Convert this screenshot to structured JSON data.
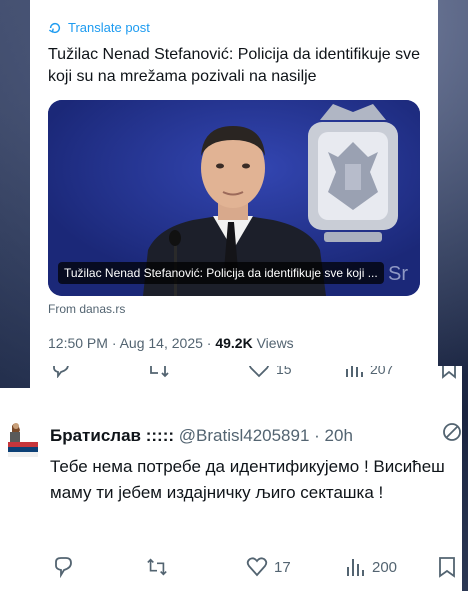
{
  "translate_label": "Translate post",
  "headline": "Tužilac Nenad Stefanović: Policija da identifikuje sve koji su na mrežama pozivali na nasilje",
  "media": {
    "caption": "Tužilac Nenad Stefanović: Policija da identifikuje sve koji ...",
    "source": "From danas.rs"
  },
  "meta": {
    "time": "12:50 PM · Aug 14, 2025 · ",
    "views_count": "49.2K",
    "views_label": " Views"
  },
  "strip": {
    "likes": "15",
    "views": "207"
  },
  "reply": {
    "name": "Братислав :::::",
    "handle": " @Bratisl4205891 · 20h",
    "text": "Тебе нема потребе да идентификујемо ! Висићеш маму ти јебем издајничку љиго секташка !",
    "likes": "17",
    "views": "200"
  },
  "colors": {
    "accent": "#1d9bf0",
    "muted": "#536471",
    "text": "#0f1419"
  }
}
